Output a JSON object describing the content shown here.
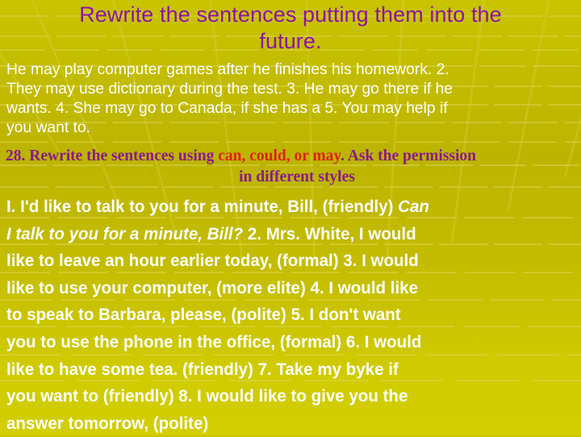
{
  "slide": {
    "title_lines": [
      "Rewrite the sentences putting them into the",
      "future."
    ],
    "exercise_text_lines": [
      "He may play computer games after he finishes his homework. 2.",
      "They may use dictionary during the test. 3. He may go there if he",
      "wants. 4. She may go to Canada, if she has a 5. You may help if",
      "you want to."
    ],
    "task28": {
      "prefix": "28. Rewrite the sentences using ",
      "modals": "can, could, or may",
      "suffix": ". Ask the permission",
      "line2": "in different styles"
    },
    "task28_lines": {
      "l1": "I. I'd like to talk to you for a minute, Bill, (friendly) ",
      "l1_italic": "Can",
      "l2_italic": "I talk to you for a minute, Bill?",
      "l2": " 2. Mrs. White, I would",
      "l3": "like to leave an hour earlier today, (formal) 3. I would",
      "l4": "like to use your computer, (more elite) 4. I would like",
      "l5": "to speak to Barbara, please, (polite) 5. I don't want",
      "l6": "you to use the phone in the office, (formal) 6. I would",
      "l7": "like to have some tea. (friendly) 7. Take my byke if",
      "l8": "you want to (friendly) 8. I would like to give you the",
      "l9": "answer tomorrow, (polite)"
    }
  }
}
